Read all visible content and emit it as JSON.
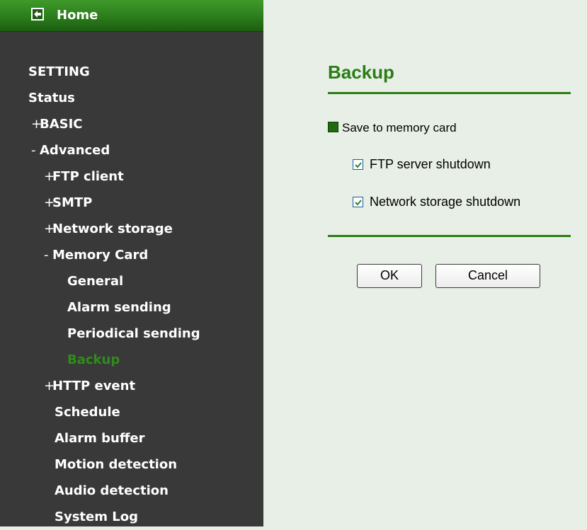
{
  "sidebar": {
    "home_label": "Home",
    "items": [
      {
        "sign": "",
        "label": "SETTING"
      },
      {
        "sign": "",
        "label": "Status"
      },
      {
        "sign": "+",
        "label": "BASIC"
      },
      {
        "sign": "-",
        "label": "Advanced"
      },
      {
        "sign": "+",
        "label": "FTP client"
      },
      {
        "sign": "+",
        "label": "SMTP"
      },
      {
        "sign": "+",
        "label": "Network storage"
      },
      {
        "sign": "-",
        "label": "Memory Card"
      },
      {
        "sign": "",
        "label": "General"
      },
      {
        "sign": "",
        "label": "Alarm sending"
      },
      {
        "sign": "",
        "label": "Periodical sending"
      },
      {
        "sign": "",
        "label": "Backup"
      },
      {
        "sign": "+",
        "label": "HTTP event"
      },
      {
        "sign": "",
        "label": "Schedule"
      },
      {
        "sign": "",
        "label": "Alarm buffer"
      },
      {
        "sign": "",
        "label": "Motion detection"
      },
      {
        "sign": "",
        "label": "Audio detection"
      },
      {
        "sign": "",
        "label": "System Log"
      }
    ]
  },
  "main": {
    "title": "Backup",
    "save_to_memory_label": "Save to memory card",
    "options": [
      {
        "label": "FTP server shutdown",
        "checked": true
      },
      {
        "label": "Network storage shutdown",
        "checked": true
      }
    ],
    "ok_label": "OK",
    "cancel_label": "Cancel"
  },
  "colors": {
    "accent_green": "#2a7d16",
    "sidebar_bg": "#393939",
    "content_bg": "#e8efe6"
  },
  "icons": {
    "home": "back-arrow-icon",
    "save_section": "green-square-icon",
    "check": "check-icon"
  }
}
